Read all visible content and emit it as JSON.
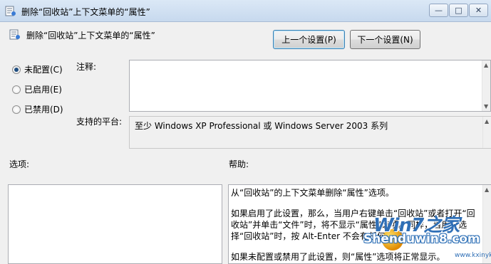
{
  "window": {
    "title": "删除“回收站”上下文菜单的“属性”",
    "title_icon": "policy-icon",
    "controls": {
      "minimize": "minimize-icon",
      "maximize": "maximize-icon",
      "close": "close-icon"
    }
  },
  "header": {
    "title": "删除“回收站”上下文菜单的“属性”",
    "icon": "policy-icon",
    "prev_button": "上一个设置(P)",
    "next_button": "下一个设置(N)"
  },
  "options": {
    "not_configured": "未配置(C)",
    "enabled": "已启用(E)",
    "disabled": "已禁用(D)",
    "selected": "not_configured"
  },
  "comment": {
    "label": "注释:",
    "value": ""
  },
  "platform": {
    "label": "支持的平台:",
    "value": "至少 Windows XP Professional 或 Windows Server 2003 系列"
  },
  "sections": {
    "options_label": "选项:",
    "help_label": "帮助:"
  },
  "help": {
    "p1": "从“回收站”的上下文菜单删除“属性”选项。",
    "p2": "如果启用了此设置，那么，当用户右键单击“回收站”或者打开“回收站”并单击“文件”时，将不显示“属性”选项。同样，当用户选择“回收站”时，按 Alt-Enter 不会有任何作用。",
    "p3": "如果未配置或禁用了此设置，则“属性”选项将正常显示。"
  },
  "watermark": {
    "top": "Win7之家",
    "mid": "Shenduwin8.com",
    "url": "www.kxinyk.com"
  },
  "colors": {
    "accent": "#3c7fb1",
    "titlebar": "#c7d9ee"
  }
}
